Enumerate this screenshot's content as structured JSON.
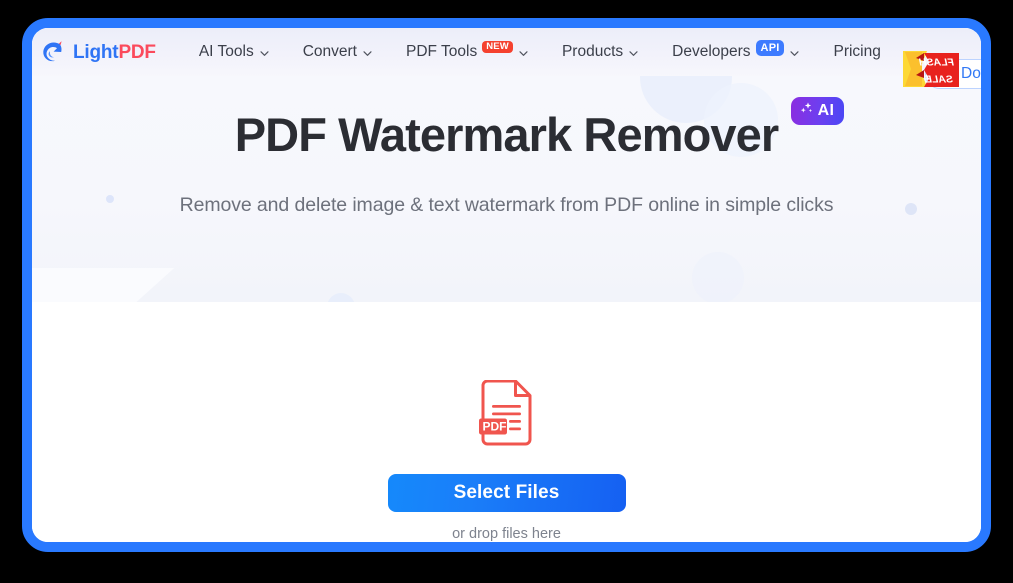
{
  "brand": {
    "logo_icon": "lightpdf-swoosh-logo-icon",
    "name_part1": "Light",
    "name_part2": "PDF"
  },
  "nav": {
    "items": [
      {
        "label": "AI Tools",
        "has_chevron": true,
        "badge": null,
        "name": "nav-item-ai-tools"
      },
      {
        "label": "Convert",
        "has_chevron": true,
        "badge": null,
        "name": "nav-item-convert"
      },
      {
        "label": "PDF Tools",
        "has_chevron": true,
        "badge": "NEW",
        "name": "nav-item-pdf-tools"
      },
      {
        "label": "Products",
        "has_chevron": true,
        "badge": null,
        "name": "nav-item-products"
      },
      {
        "label": "Developers",
        "has_chevron": true,
        "badge": "API",
        "name": "nav-item-developers"
      },
      {
        "label": "Pricing",
        "has_chevron": false,
        "badge": null,
        "name": "nav-item-pricing"
      }
    ],
    "flash_sale": {
      "line1": "FLASH",
      "line2": "SALE",
      "mirrored": true,
      "color": "#e8221e"
    },
    "download": {
      "label": "Download",
      "icon": "download-arrow-icon",
      "accent": "#3279f5"
    }
  },
  "hero": {
    "title": "PDF Watermark Remover",
    "ai_badge": {
      "label": "AI",
      "icon": "sparkle-icon",
      "gradient_from": "#8b2ee0",
      "gradient_to": "#4a47f5"
    },
    "subtitle": "Remove and delete image & text watermark from PDF online in simple clicks"
  },
  "dropzone": {
    "file_icon": "pdf-file-icon",
    "file_icon_label": "PDF",
    "file_icon_color": "#f0554e",
    "select_button_label": "Select Files",
    "select_button_color": "#1a7ef9",
    "drop_hint": "or drop files here"
  },
  "frame": {
    "border_color": "#2979ff"
  }
}
